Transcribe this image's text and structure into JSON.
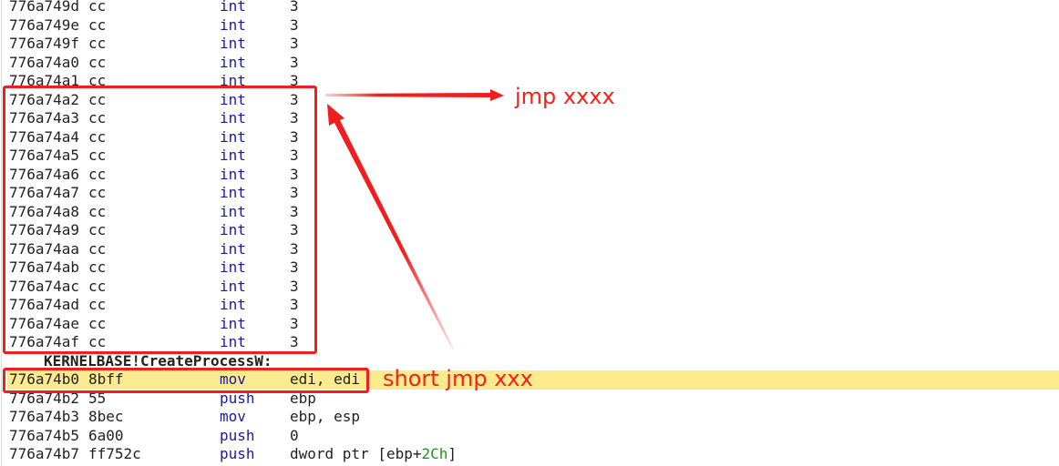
{
  "disassembly": {
    "rows_before": [
      {
        "addr": "776a749d",
        "bytes": "cc",
        "mnemonic": "int",
        "operand": "3"
      },
      {
        "addr": "776a749e",
        "bytes": "cc",
        "mnemonic": "int",
        "operand": "3"
      },
      {
        "addr": "776a749f",
        "bytes": "cc",
        "mnemonic": "int",
        "operand": "3"
      },
      {
        "addr": "776a74a0",
        "bytes": "cc",
        "mnemonic": "int",
        "operand": "3"
      },
      {
        "addr": "776a74a1",
        "bytes": "cc",
        "mnemonic": "int",
        "operand": "3"
      },
      {
        "addr": "776a74a2",
        "bytes": "cc",
        "mnemonic": "int",
        "operand": "3"
      },
      {
        "addr": "776a74a3",
        "bytes": "cc",
        "mnemonic": "int",
        "operand": "3"
      },
      {
        "addr": "776a74a4",
        "bytes": "cc",
        "mnemonic": "int",
        "operand": "3"
      },
      {
        "addr": "776a74a5",
        "bytes": "cc",
        "mnemonic": "int",
        "operand": "3"
      },
      {
        "addr": "776a74a6",
        "bytes": "cc",
        "mnemonic": "int",
        "operand": "3"
      },
      {
        "addr": "776a74a7",
        "bytes": "cc",
        "mnemonic": "int",
        "operand": "3"
      },
      {
        "addr": "776a74a8",
        "bytes": "cc",
        "mnemonic": "int",
        "operand": "3"
      },
      {
        "addr": "776a74a9",
        "bytes": "cc",
        "mnemonic": "int",
        "operand": "3"
      },
      {
        "addr": "776a74aa",
        "bytes": "cc",
        "mnemonic": "int",
        "operand": "3"
      },
      {
        "addr": "776a74ab",
        "bytes": "cc",
        "mnemonic": "int",
        "operand": "3"
      },
      {
        "addr": "776a74ac",
        "bytes": "cc",
        "mnemonic": "int",
        "operand": "3"
      },
      {
        "addr": "776a74ad",
        "bytes": "cc",
        "mnemonic": "int",
        "operand": "3"
      },
      {
        "addr": "776a74ae",
        "bytes": "cc",
        "mnemonic": "int",
        "operand": "3"
      },
      {
        "addr": "776a74af",
        "bytes": "cc",
        "mnemonic": "int",
        "operand": "3"
      }
    ],
    "symbol_label": "KERNELBASE!CreateProcessW:",
    "rows_after": [
      {
        "addr": "776a74b0",
        "bytes": "8bff",
        "mnemonic": "mov",
        "operand": "edi, edi",
        "highlighted": true
      },
      {
        "addr": "776a74b2",
        "bytes": "55",
        "mnemonic": "push",
        "operand": "ebp"
      },
      {
        "addr": "776a74b3",
        "bytes": "8bec",
        "mnemonic": "mov",
        "operand": "ebp, esp"
      },
      {
        "addr": "776a74b5",
        "bytes": "6a00",
        "mnemonic": "push",
        "operand": "0"
      },
      {
        "addr": "776a74b7",
        "bytes": "ff752c",
        "mnemonic": "push",
        "operand_prefix": "dword ptr [ebp+",
        "operand_number": "2Ch",
        "operand_suffix": "]"
      }
    ]
  },
  "annotations": {
    "top_label": "jmp xxxx",
    "bottom_label": "short jmp xxx"
  },
  "colors": {
    "annotation_red": "#f01f1f",
    "highlight_yellow": "#fbeb8e",
    "mnemonic_blue": "#1a1aa6",
    "number_green": "#1a9a1a"
  }
}
